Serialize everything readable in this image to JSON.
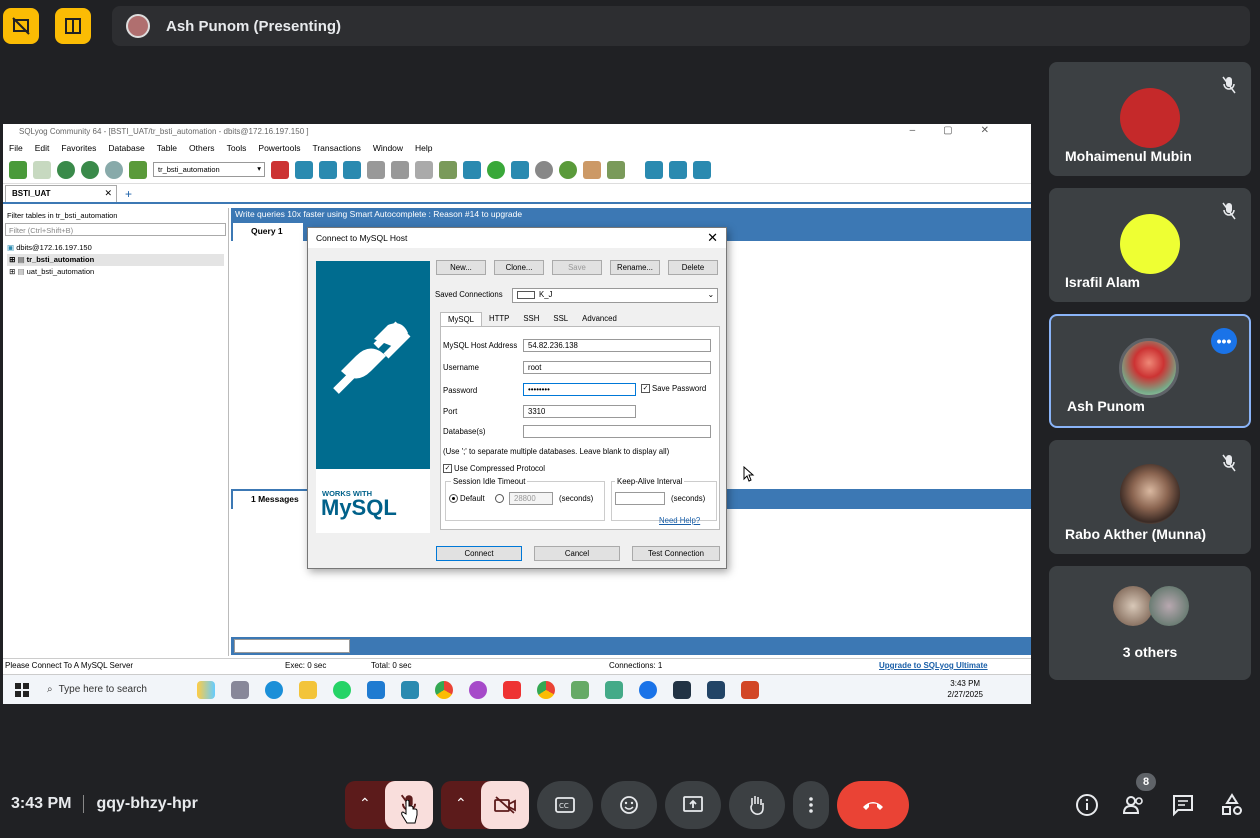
{
  "meet": {
    "presenter_label": "Ash Punom (Presenting)",
    "time": "3:43 PM",
    "meeting_code": "gqy-bhzy-hpr",
    "people_count": "8",
    "participants": [
      {
        "name": "Mohaimenul Mubin",
        "avatar_color": "#c5292a",
        "muted": true
      },
      {
        "name": "Israfil Alam",
        "avatar_color": "#eeff33",
        "muted": true
      },
      {
        "name": "Ash Punom",
        "avatar_color": "#d44",
        "muted": false,
        "active": true
      },
      {
        "name": "Rabo Akther (Munna)",
        "avatar_color": "#6a4a3a",
        "muted": true
      }
    ],
    "others_label": "3 others"
  },
  "sqlyog": {
    "window_title": "SQLyog Community 64 - [BSTI_UAT/tr_bsti_automation - dbits@172.16.197.150 ]",
    "menu": [
      "File",
      "Edit",
      "Favorites",
      "Database",
      "Table",
      "Others",
      "Tools",
      "Powertools",
      "Transactions",
      "Window",
      "Help"
    ],
    "db_select": "tr_bsti_automation",
    "connection_tab": "BSTI_UAT",
    "filter_label": "Filter tables in tr_bsti_automation",
    "filter_placeholder": "Filter (Ctrl+Shift+B)",
    "tree": {
      "host": "dbits@172.16.197.150",
      "db1": "tr_bsti_automation",
      "db2": "uat_bsti_automation"
    },
    "banner": "Write queries 10x faster using Smart Autocomplete : Reason #14 to upgrade",
    "query_tab": "Query 1",
    "messages_tab": "1 Messages",
    "status": {
      "left": "Please Connect To A MySQL Server",
      "exec": "Exec: 0 sec",
      "total": "Total: 0 sec",
      "connections": "Connections: 1",
      "upgrade": "Upgrade to SQLyog Ultimate"
    },
    "taskbar": {
      "search_placeholder": "Type here to search",
      "clock_time": "3:43 PM",
      "clock_date": "2/27/2025"
    }
  },
  "dialog": {
    "title": "Connect to MySQL Host",
    "buttons": {
      "new": "New...",
      "clone": "Clone...",
      "save": "Save",
      "rename": "Rename...",
      "delete": "Delete"
    },
    "saved_connections_label": "Saved Connections",
    "saved_connection": "K_J",
    "tabs": [
      "MySQL",
      "HTTP",
      "SSH",
      "SSL",
      "Advanced"
    ],
    "host_label": "MySQL Host Address",
    "host_value": "54.82.236.138",
    "username_label": "Username",
    "username_value": "root",
    "password_label": "Password",
    "password_value": "••••••••",
    "save_password_label": "Save Password",
    "port_label": "Port",
    "port_value": "3310",
    "databases_label": "Database(s)",
    "databases_value": "",
    "databases_hint": "(Use ';' to separate multiple databases. Leave blank to display all)",
    "compressed_label": "Use Compressed Protocol",
    "session_timeout_label": "Session Idle Timeout",
    "default_label": "Default",
    "timeout_value": "28800",
    "seconds_label": "(seconds)",
    "keepalive_label": "Keep-Alive Interval",
    "keepalive_value": "",
    "need_help": "Need Help?",
    "connect": "Connect",
    "cancel": "Cancel",
    "test": "Test Connection",
    "logo_works_with": "WORKS WITH",
    "logo_mysql": "MySQL"
  }
}
